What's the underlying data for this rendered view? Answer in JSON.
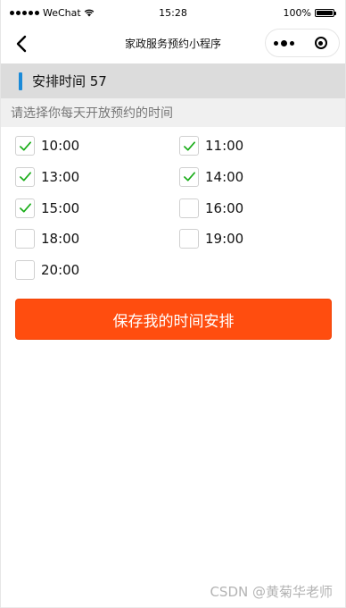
{
  "status_bar": {
    "carrier": "WeChat",
    "time": "15:28",
    "battery": "100%",
    "battery_level": 1.0
  },
  "nav": {
    "title": "家政服务预约小程序",
    "back_icon": "chevron-left-icon",
    "more_icon": "more-dots-icon",
    "close_icon": "target-circle-icon"
  },
  "section": {
    "title": "安排时间 57",
    "accent_color": "#1a8ad8"
  },
  "hint": "请选择你每天开放预约的时间",
  "time_slots": [
    {
      "label": "10:00",
      "checked": true
    },
    {
      "label": "11:00",
      "checked": true
    },
    {
      "label": "13:00",
      "checked": true
    },
    {
      "label": "14:00",
      "checked": true
    },
    {
      "label": "15:00",
      "checked": true
    },
    {
      "label": "16:00",
      "checked": false
    },
    {
      "label": "18:00",
      "checked": false
    },
    {
      "label": "19:00",
      "checked": false
    },
    {
      "label": "20:00",
      "checked": false
    }
  ],
  "save_button": {
    "label": "保存我的时间安排",
    "color": "#ff4d0f"
  },
  "check_color": "#1aad19",
  "watermark": "CSDN @黄菊华老师"
}
